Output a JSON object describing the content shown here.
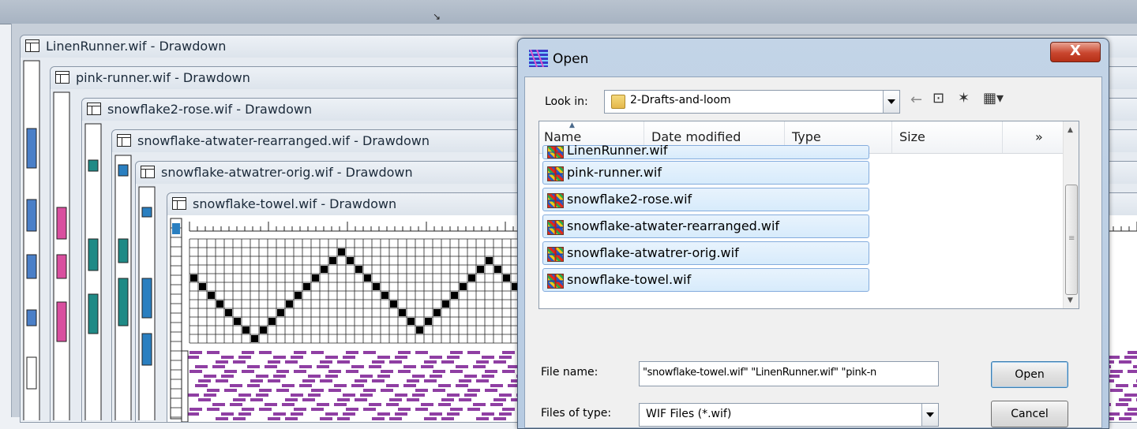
{
  "mdi_windows": [
    {
      "title": "LinenRunner.wif - Drawdown"
    },
    {
      "title": "pink-runner.wif - Drawdown"
    },
    {
      "title": "snowflake2-rose.wif - Drawdown"
    },
    {
      "title": "snowflake-atwater-rearranged.wif - Drawdown"
    },
    {
      "title": "snowflake-atwatrer-orig.wif - Drawdown"
    },
    {
      "title": "snowflake-towel.wif - Drawdown"
    }
  ],
  "dialog": {
    "title": "Open",
    "close_label": "X",
    "look_in_label": "Look in:",
    "look_in_value": "2-Drafts-and-loom",
    "columns": [
      "Name",
      "Date modified",
      "Type",
      "Size"
    ],
    "more_columns": "»",
    "files": [
      "LinenRunner.wif",
      "pink-runner.wif",
      "snowflake2-rose.wif",
      "snowflake-atwater-rearranged.wif",
      "snowflake-atwatrer-orig.wif",
      "snowflake-towel.wif"
    ],
    "file_name_label": "File name:",
    "file_name_value": "\"snowflake-towel.wif\" \"LinenRunner.wif\" \"pink-n",
    "files_of_type_label": "Files of type:",
    "files_of_type_value": "WIF Files (*.wif)",
    "open_button": "Open",
    "cancel_button": "Cancel"
  },
  "colors": {
    "weave_purple": "#8f3fa3",
    "pink": "#d94f9f",
    "teal": "#1f8a86",
    "blue": "#4a7fc8"
  },
  "icons": {
    "resize": "↘"
  }
}
